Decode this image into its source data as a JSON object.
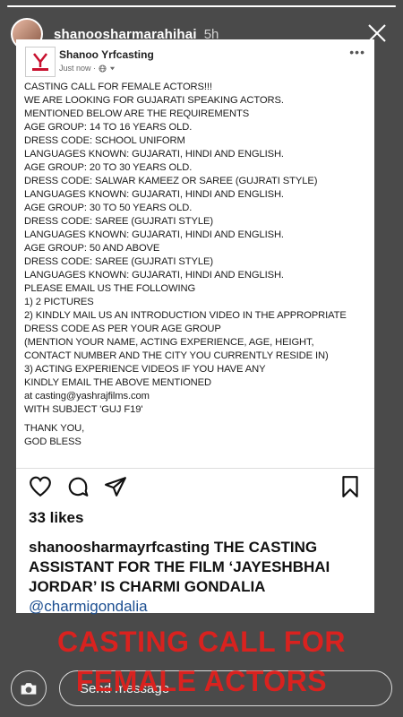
{
  "story": {
    "username": "shanoosharmarahihai",
    "time": "5h",
    "progress": 1.0
  },
  "fb_post": {
    "page_name": "Shanoo Yrfcasting",
    "meta": "Just now ·",
    "body": [
      "CASTING CALL FOR FEMALE ACTORS!!!",
      "WE ARE LOOKING FOR GUJARATI SPEAKING ACTORS.",
      "MENTIONED BELOW ARE THE REQUIREMENTS",
      "AGE GROUP: 14 TO 16 YEARS OLD.",
      "DRESS CODE: SCHOOL UNIFORM",
      "LANGUAGES KNOWN: GUJARATI, HINDI AND ENGLISH.",
      "AGE GROUP: 20 TO 30 YEARS OLD.",
      "DRESS CODE: SALWAR KAMEEZ OR SAREE (GUJRATI STYLE)",
      "LANGUAGES KNOWN: GUJARATI, HINDI AND ENGLISH.",
      "AGE GROUP: 30 TO 50 YEARS OLD.",
      "DRESS CODE: SAREE (GUJRATI STYLE)",
      "LANGUAGES KNOWN: GUJARATI, HINDI AND ENGLISH.",
      "AGE GROUP: 50 AND ABOVE",
      "DRESS CODE: SAREE (GUJRATI STYLE)",
      "LANGUAGES KNOWN: GUJARATI, HINDI AND ENGLISH.",
      "PLEASE EMAIL US THE FOLLOWING",
      "1) 2 PICTURES",
      "2) KINDLY MAIL US AN INTRODUCTION VIDEO IN THE APPROPRIATE",
      "DRESS CODE AS PER YOUR AGE GROUP",
      "(MENTION YOUR NAME, ACTING EXPERIENCE, AGE, HEIGHT,",
      "CONTACT NUMBER AND THE CITY YOU CURRENTLY RESIDE IN)",
      "3) ACTING EXPERIENCE VIDEOS IF YOU HAVE ANY",
      "KINDLY EMAIL THE ABOVE MENTIONED",
      "at casting@yashrajfilms.com",
      "WITH SUBJECT 'GUJ F19'"
    ],
    "signoff": [
      "THANK YOU,",
      "GOD BLESS"
    ]
  },
  "ig_post": {
    "likes": "33 likes",
    "caption_user": "shanoosharmayrfcasting",
    "caption_text": " THE CASTING ASSISTANT FOR THE FILM ‘JAYESHBHAI JORDAR’ IS CHARMI GONDALIA ",
    "caption_mention": "@charmigondalia"
  },
  "overlay": {
    "line1": "CASTING CALL FOR",
    "line2": "FEMALE ACTORS",
    "color": "#d9221f"
  },
  "reply": {
    "placeholder": "Send message"
  },
  "icons": [
    "close-icon",
    "globe-icon",
    "heart-icon",
    "comment-icon",
    "share-icon",
    "bookmark-icon",
    "camera-icon",
    "more-icon"
  ]
}
